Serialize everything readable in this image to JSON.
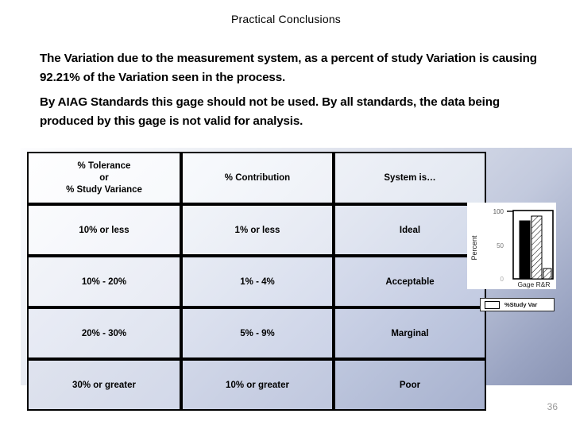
{
  "slide": {
    "title": "Practical Conclusions",
    "page_number": "36"
  },
  "body": {
    "paragraph_1": "The Variation due to the measurement system, as a percent of study Variation is causing 92.21% of the Variation seen in the process.",
    "paragraph_2": "By AIAG Standards this gage should not be used.  By all standards, the data being produced by this gage is not valid for analysis."
  },
  "table": {
    "headers": {
      "col_1_line_1": "%  Tolerance",
      "col_1_line_2": "or",
      "col_1_line_3": "%  Study Variance",
      "col_2": "%  Contribution",
      "col_3": "System is…"
    },
    "rows": [
      {
        "tolerance": "10% or less",
        "contribution": "1% or less",
        "system": "Ideal"
      },
      {
        "tolerance": "10%  - 20%",
        "contribution": "1%  - 4%",
        "system": "Acceptable"
      },
      {
        "tolerance": "20%  - 30%",
        "contribution": "5%  - 9%",
        "system": "Marginal"
      },
      {
        "tolerance": "30%  or greater",
        "contribution": "10%  or greater",
        "system": "Poor"
      }
    ]
  },
  "chart_data": {
    "type": "bar",
    "title": "",
    "xlabel": "Gage R&R",
    "ylabel": "Percent",
    "categories": [
      "Gage R&R"
    ],
    "ylim": [
      0,
      100
    ],
    "yticks": [
      "0",
      "50",
      "100"
    ],
    "grid": false,
    "legend_position": "bottom",
    "legend": [
      "%Study Var"
    ],
    "series": [
      {
        "name": "bar-1",
        "fill": "solid",
        "values": [
          85
        ]
      },
      {
        "name": "bar-2",
        "fill": "hatch",
        "values": [
          92
        ]
      },
      {
        "name": "bar-3",
        "fill": "hatch",
        "values": [
          15
        ]
      }
    ]
  },
  "colors": {
    "panel_light": "#fdfdfe",
    "panel_dark": "#8a94b4",
    "border": "#000000",
    "page_number": "#9a9a9a"
  }
}
